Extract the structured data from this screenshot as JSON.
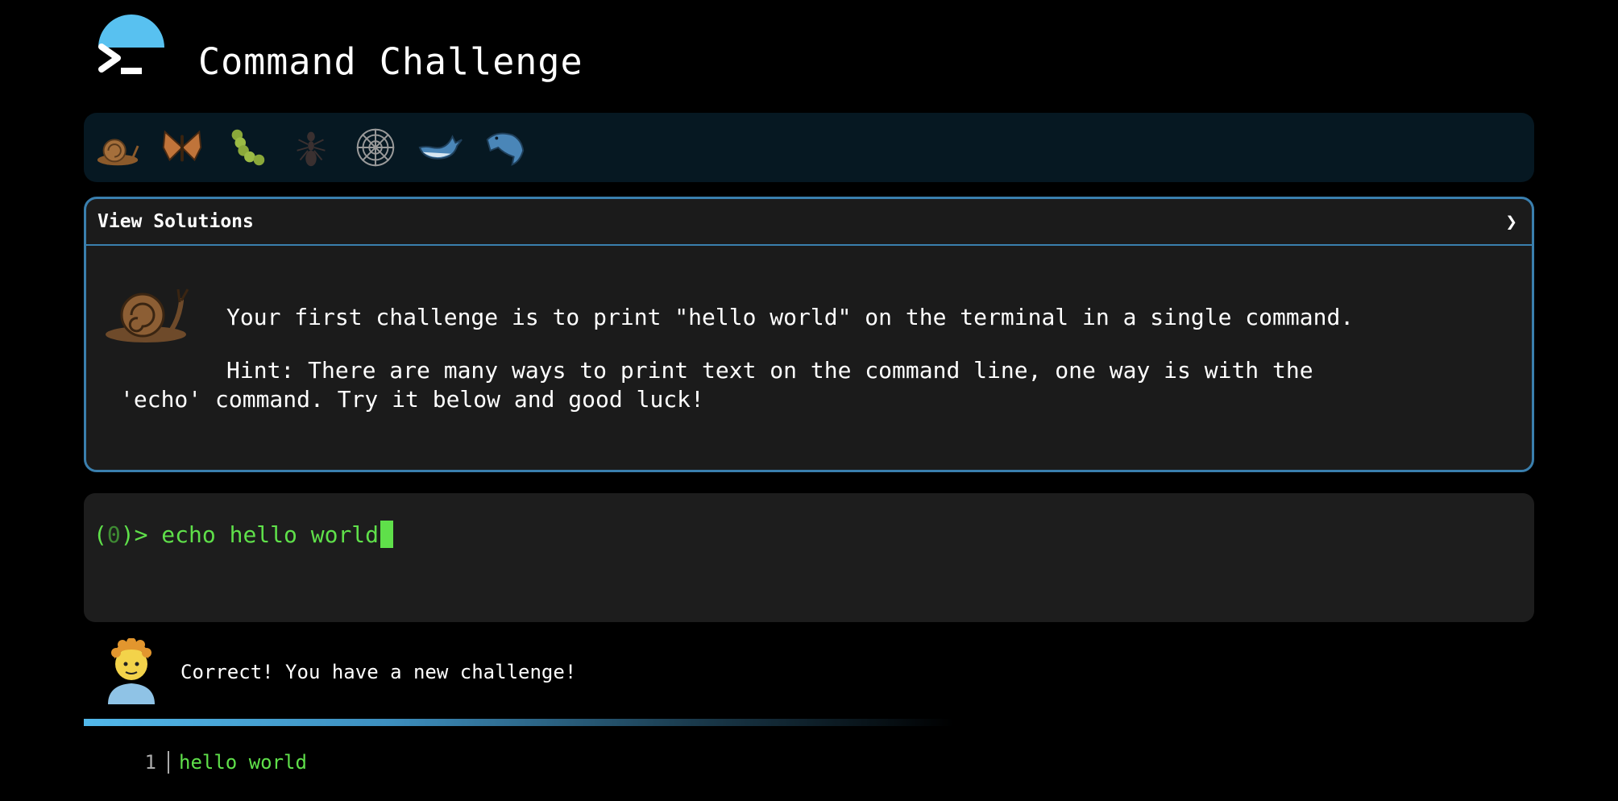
{
  "header": {
    "title": "Command Challenge",
    "logo_icon": "terminal-prompt-icon"
  },
  "levels": [
    {
      "icon": "snail-icon"
    },
    {
      "icon": "butterfly-icon"
    },
    {
      "icon": "caterpillar-icon"
    },
    {
      "icon": "ant-icon"
    },
    {
      "icon": "spider-web-icon"
    },
    {
      "icon": "whale-icon"
    },
    {
      "icon": "dolphin-icon"
    }
  ],
  "panel": {
    "title": "View Solutions",
    "toggle": "❯",
    "challenge": "Your first challenge is to print \"hello world\" on the terminal in a single command.",
    "hint_line1": "Hint: There are many ways to print text on the command line, one way is with the",
    "hint_line2": "'echo' command. Try it below and good luck!"
  },
  "terminal": {
    "prompt_open": "(",
    "prompt_count": "0",
    "prompt_close": ")> ",
    "command": "echo hello world"
  },
  "feedback": {
    "message": "Correct! You have a new challenge!"
  },
  "output": {
    "lines": [
      {
        "number": "1",
        "text": "hello world"
      }
    ]
  },
  "colors": {
    "accent": "#3a7fae",
    "terminal_green": "#5fe04a",
    "background": "#000000",
    "panel_bg": "#1b1b1b"
  }
}
